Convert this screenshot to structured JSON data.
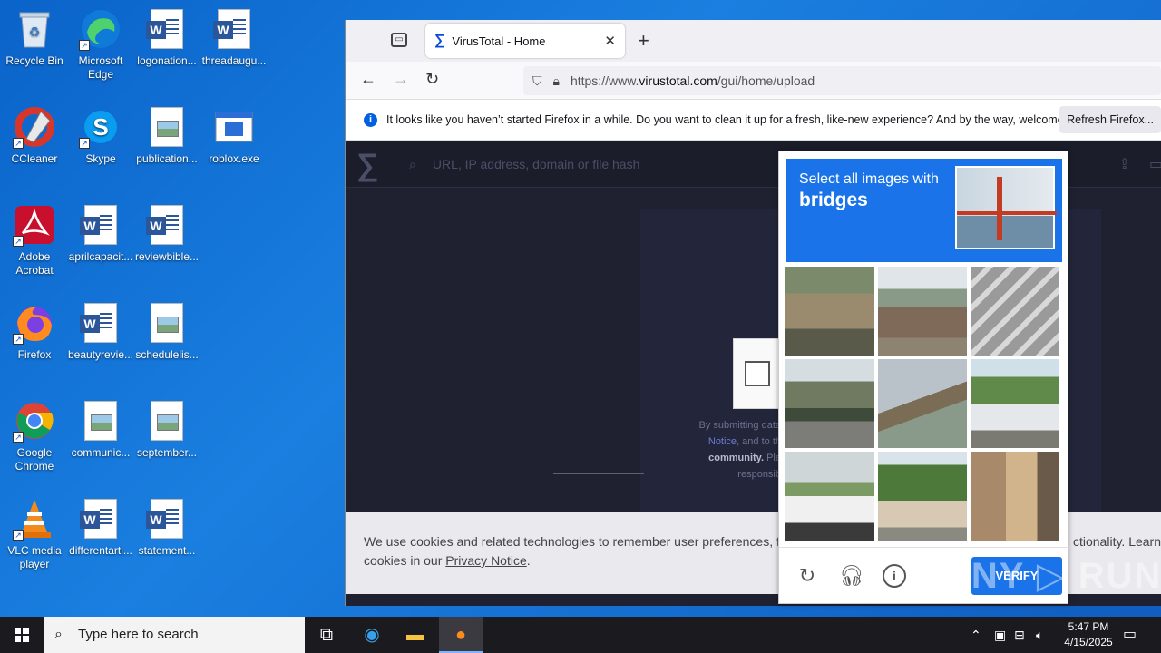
{
  "desktop": {
    "icons": [
      {
        "label": "Recycle Bin"
      },
      {
        "label": "Microsoft Edge"
      },
      {
        "label": "logonation..."
      },
      {
        "label": "threadaugu..."
      },
      {
        "label": "CCleaner"
      },
      {
        "label": "Skype"
      },
      {
        "label": "publication..."
      },
      {
        "label": "roblox.exe"
      },
      {
        "label": "Adobe Acrobat"
      },
      {
        "label": "aprilcapacit..."
      },
      {
        "label": "reviewbible..."
      },
      {
        "label": "Firefox"
      },
      {
        "label": "beautyrevie..."
      },
      {
        "label": "schedulelis..."
      },
      {
        "label": "Google Chrome"
      },
      {
        "label": "communic..."
      },
      {
        "label": "september..."
      },
      {
        "label": "VLC media player"
      },
      {
        "label": "differentarti..."
      },
      {
        "label": "statement..."
      }
    ]
  },
  "browser": {
    "tab_title": "VirusTotal - Home",
    "url_prefix": "https://www.",
    "url_domain": "virustotal.com",
    "url_path": "/gui/home/upload",
    "notice_text": "It looks like you haven’t started Firefox in a while. Do you want to clean it up for a fresh, like-new experience? And by the way, welcome back!",
    "notice_button": "Refresh Firefox..."
  },
  "vt": {
    "search_placeholder": "URL, IP address, domain or file hash",
    "submit_text_1": "By submitting data",
    "submit_text_2": "Notice",
    "submit_text_3": ", and to th",
    "submit_text_4": "community.",
    "submit_text_5": " Ple",
    "submit_text_6": "responsib",
    "cookie_text_1": "We use cookies and related technologies to remember user preferences, for",
    "cookie_text_right": "ctionality. Learn",
    "cookie_text_2": "cookies in our ",
    "cookie_link": "Privacy Notice",
    "cookie_text_3": "."
  },
  "captcha": {
    "prompt_line1": "Select all images with",
    "prompt_line2": "bridges",
    "verify_label": "VERIFY"
  },
  "watermark": "ANY ▷ RUN",
  "taskbar": {
    "search_placeholder": "Type here to search",
    "time": "5:47 PM",
    "date": "4/15/2025"
  }
}
